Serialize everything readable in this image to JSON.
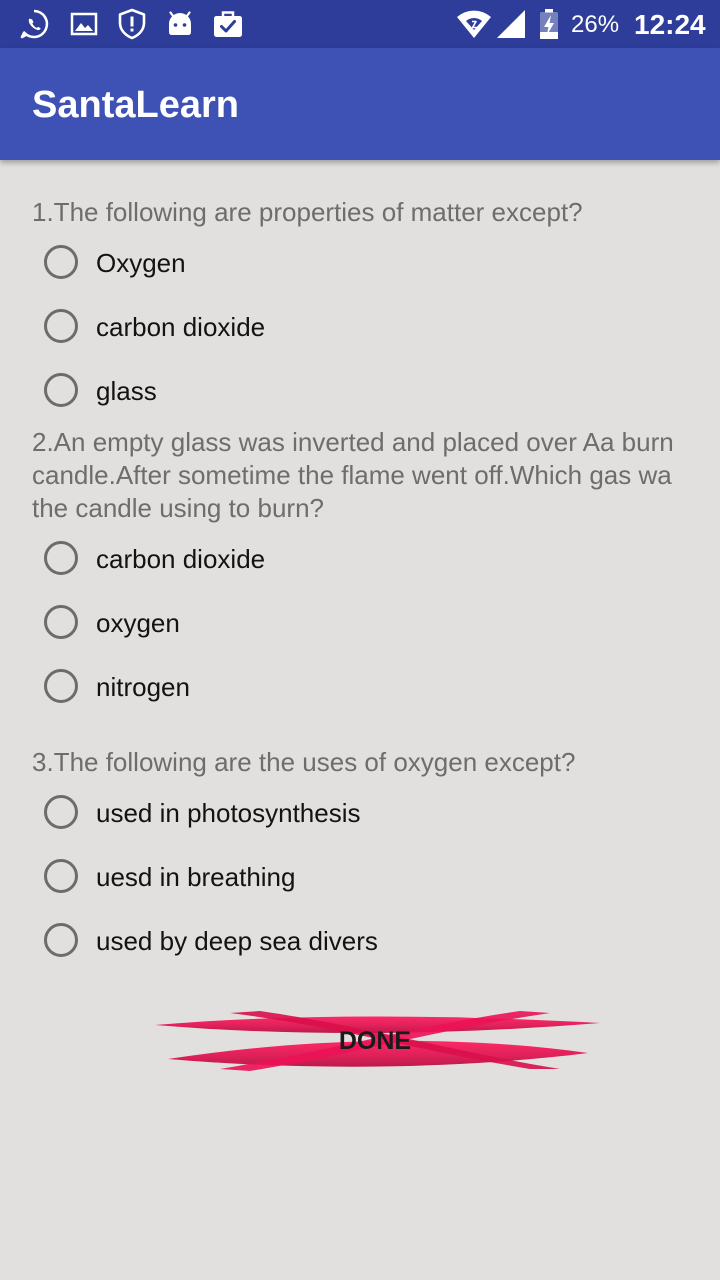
{
  "status_bar": {
    "icons": [
      "whatsapp-icon",
      "gallery-icon",
      "shield-alert-icon",
      "android-icon",
      "briefcase-check-icon",
      "wifi-icon",
      "cell-signal-icon",
      "battery-charging-icon"
    ],
    "battery": "26%",
    "time": "12:24"
  },
  "app_bar": {
    "title": "SantaLearn",
    "color": "#3e51b5",
    "status_color": "#2d3d99"
  },
  "quiz": {
    "questions": [
      {
        "text": "1.The following are properties of matter except?",
        "options": [
          "Oxygen",
          "carbon dioxide",
          "glass"
        ]
      },
      {
        "text": "2.An empty glass was inverted and placed over Aa burn\ncandle.After sometime the flame went off.Which gas wa\nthe candle using to burn?",
        "options": [
          "carbon dioxide",
          "oxygen",
          "nitrogen"
        ]
      },
      {
        "text": "3.The following are the uses of oxygen except?",
        "options": [
          "used in photosynthesis",
          "uesd in breathing",
          "used by deep sea divers"
        ]
      }
    ]
  },
  "done_button": {
    "label": "DONE",
    "color": "#e0104e"
  }
}
